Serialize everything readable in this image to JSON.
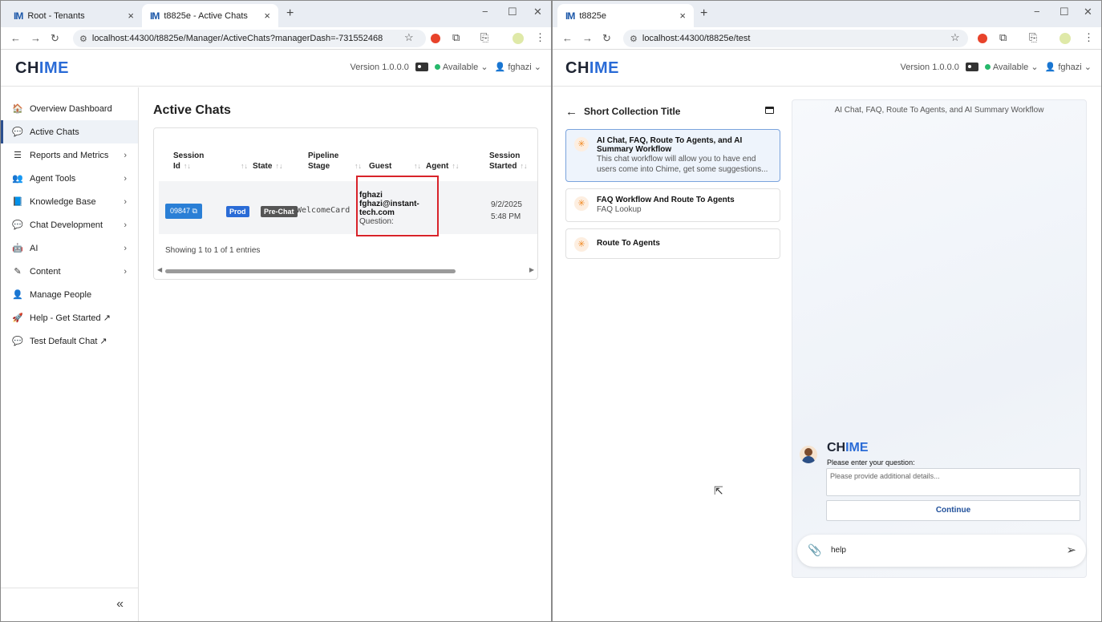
{
  "left_window": {
    "tabs": [
      {
        "favicon": "IM",
        "title": "Root - Tenants",
        "active": false
      },
      {
        "favicon": "IM",
        "title": "t8825e - Active Chats",
        "active": true
      }
    ],
    "url": "localhost:44300/t8825e/Manager/ActiveChats?managerDash=-731552468",
    "app": {
      "logo_left": "CH",
      "logo_accent": "IME",
      "version": "Version 1.0.0.0",
      "status": "Available",
      "user": "fghazi"
    },
    "sidebar": {
      "items": [
        {
          "icon": "home-icon",
          "glyph": "🏠",
          "label": "Overview Dashboard",
          "chevron": false,
          "active": false
        },
        {
          "icon": "chats-icon",
          "glyph": "💬",
          "label": "Active Chats",
          "chevron": false,
          "active": true
        },
        {
          "icon": "reports-icon",
          "glyph": "☰",
          "label": "Reports and Metrics",
          "chevron": true,
          "active": false
        },
        {
          "icon": "agent-tools-icon",
          "glyph": "👥",
          "label": "Agent Tools",
          "chevron": true,
          "active": false
        },
        {
          "icon": "knowledge-base-icon",
          "glyph": "📘",
          "label": "Knowledge Base",
          "chevron": true,
          "active": false
        },
        {
          "icon": "chat-development-icon",
          "glyph": "💬",
          "label": "Chat Development",
          "chevron": true,
          "active": false
        },
        {
          "icon": "ai-icon",
          "glyph": "🤖",
          "label": "AI",
          "chevron": true,
          "active": false
        },
        {
          "icon": "content-icon",
          "glyph": "✎",
          "label": "Content",
          "chevron": true,
          "active": false
        },
        {
          "icon": "person-icon",
          "glyph": "👤",
          "label": "Manage People",
          "chevron": false,
          "active": false
        },
        {
          "icon": "rocket-icon",
          "glyph": "🚀",
          "label": "Help - Get Started ↗",
          "chevron": false,
          "active": false
        },
        {
          "icon": "chat-bubble-icon",
          "glyph": "💬",
          "label": "Test Default Chat ↗",
          "chevron": false,
          "active": false
        }
      ],
      "collapse": "«"
    },
    "page_title": "Active Chats",
    "table": {
      "headers": {
        "session_id": "Session Id",
        "state": "State",
        "pipeline_stage": "Pipeline Stage",
        "guest": "Guest",
        "agent": "Agent",
        "session_started": "Session Started"
      },
      "row": {
        "session_id": "09847",
        "env": "Prod",
        "state": "Pre-Chat",
        "stage": "WelcomeCard",
        "guest_name": "fghazi",
        "guest_email_1": "fghazi@instant-",
        "guest_email_2": "tech.com",
        "guest_question": "Question:",
        "started_date": "9/2/2025",
        "started_time": "5:48 PM"
      },
      "footer": "Showing 1 to 1 of 1 entries"
    }
  },
  "right_window": {
    "tabs": [
      {
        "favicon": "IM",
        "title": "t8825e",
        "active": true
      }
    ],
    "url": "localhost:44300/t8825e/test",
    "app": {
      "logo_left": "CH",
      "logo_accent": "IME",
      "version": "Version 1.0.0.0",
      "status": "Available",
      "user": "fghazi"
    },
    "collection_title": "Short Collection Title",
    "workflows": [
      {
        "title": "AI Chat, FAQ, Route To Agents, and AI Summary Workflow",
        "desc": "This chat workflow will allow you to have end users come into Chime, get some suggestions...",
        "selected": true
      },
      {
        "title": "FAQ Workflow And Route To Agents",
        "desc": "FAQ Lookup",
        "selected": false
      },
      {
        "title": "Route To Agents",
        "desc": "",
        "selected": false
      }
    ],
    "chat": {
      "header": "AI Chat, FAQ, Route To Agents, and AI Summary Workflow",
      "bot_logo_left": "CH",
      "bot_logo_accent": "IME",
      "prompt": "Please enter your question:",
      "placeholder": "Please provide additional details...",
      "continue_label": "Continue",
      "input_value": "help"
    }
  },
  "colors": {
    "accent_blue": "#2a6bd6",
    "session_button": "#2a7fd6",
    "prod_badge": "#2a6bd6",
    "prechat_badge": "#555555",
    "highlight_box": "#d8232a",
    "available_green": "#26b86b"
  }
}
